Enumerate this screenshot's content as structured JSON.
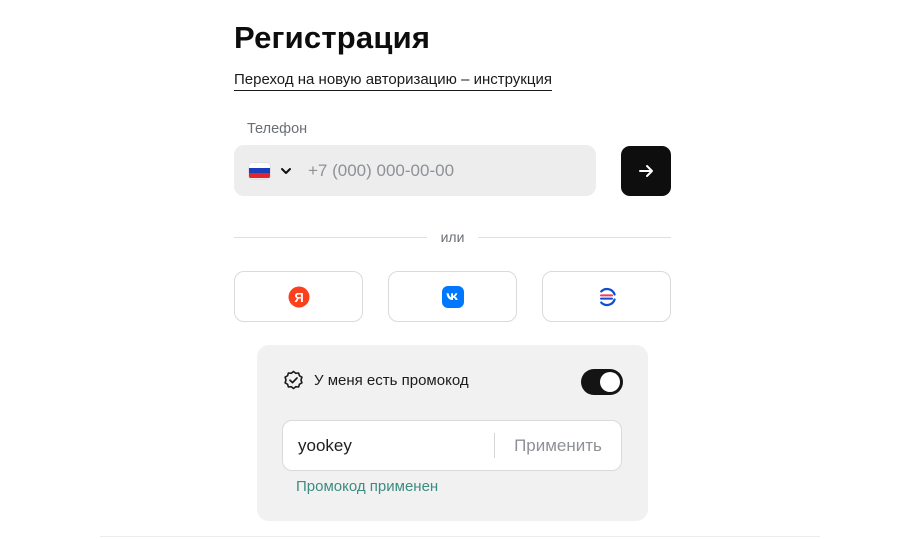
{
  "page": {
    "title": "Регистрация",
    "instruction_link": "Переход на новую авторизацию – инструкция"
  },
  "phone": {
    "label": "Телефон",
    "placeholder": "+7 (000) 000-00-00",
    "country_flag_icon": "russia-flag-icon",
    "dropdown_icon": "chevron-down-icon",
    "submit_icon": "arrow-right-icon"
  },
  "divider": {
    "text": "или"
  },
  "social": [
    {
      "name": "yandex",
      "icon": "yandex-logo-icon",
      "color": "#fc3f1d",
      "letter": "Я"
    },
    {
      "name": "vk",
      "icon": "vk-logo-icon",
      "color": "#0077ff"
    },
    {
      "name": "gosuslugi",
      "icon": "gosuslugi-logo-icon",
      "colors": [
        "#ee3f58",
        "#0d4cd3"
      ]
    }
  ],
  "promo": {
    "header_icon": "badge-check-icon",
    "header_label": "У меня есть промокод",
    "toggle_on": true,
    "value": "yookey",
    "apply_label": "Применить",
    "status_text": "Промокод применен",
    "status_color": "#3d8c80"
  }
}
